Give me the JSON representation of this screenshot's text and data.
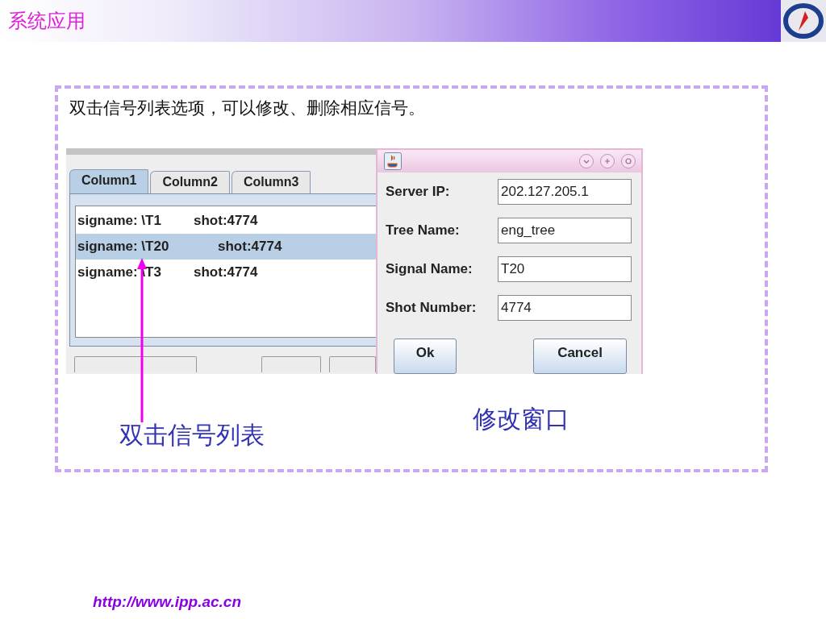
{
  "header": {
    "title": "系统应用"
  },
  "instruction": "双击信号列表选项，可以修改、删除相应信号。",
  "app": {
    "tabs": [
      {
        "label": "Column1",
        "selected": true
      },
      {
        "label": "Column2",
        "selected": false
      },
      {
        "label": "Column3",
        "selected": false
      }
    ],
    "rows": [
      {
        "name": "signame: \\T1",
        "shot": "shot:4774",
        "selected": false
      },
      {
        "name": "signame: \\T20",
        "shot": "shot:4774",
        "selected": true
      },
      {
        "name": "signame: \\T3",
        "shot": "shot:4774",
        "selected": false
      }
    ]
  },
  "dialog": {
    "fields": [
      {
        "label": "Server IP:",
        "value": "202.127.205.1"
      },
      {
        "label": "Tree Name:",
        "value": "eng_tree"
      },
      {
        "label": "Signal Name:",
        "value": "T20"
      },
      {
        "label": "Shot Number:",
        "value": "4774"
      }
    ],
    "buttons": [
      "Ok",
      "Cancel"
    ]
  },
  "captions": [
    "双击信号列表",
    "修改窗口"
  ],
  "footer": {
    "url": "http://www.ipp.ac.cn"
  }
}
